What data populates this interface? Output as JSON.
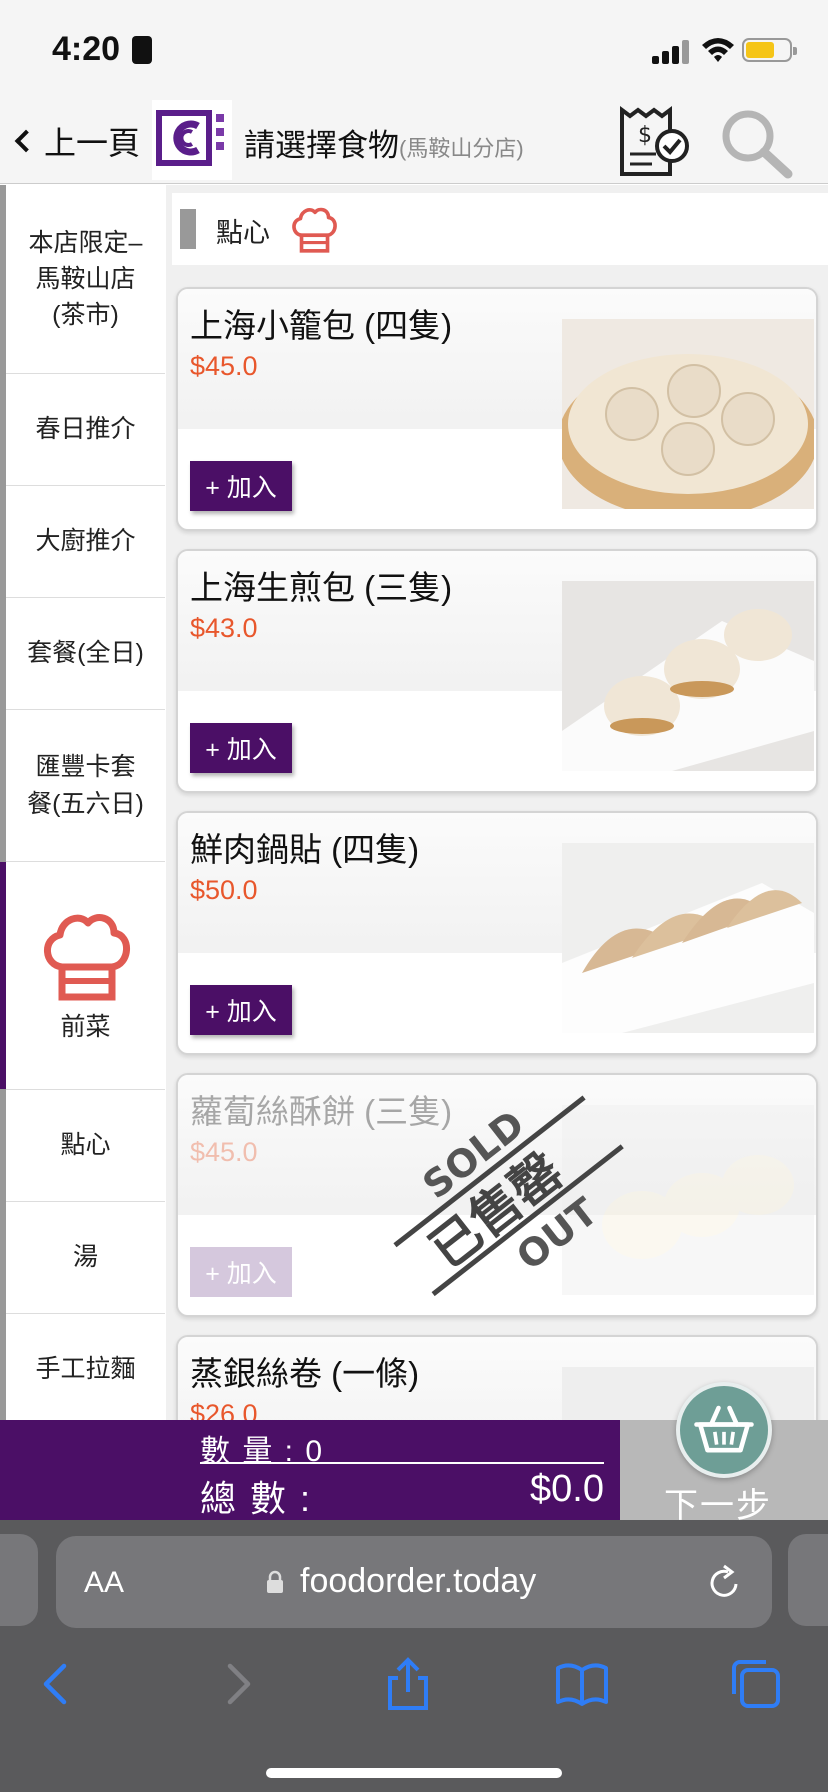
{
  "status": {
    "time": "4:20"
  },
  "header": {
    "back_label": "上一頁",
    "title": "請選擇食物",
    "branch": "(馬鞍山分店)"
  },
  "sidebar": {
    "items": [
      {
        "label": "本店限定–\n馬鞍山店\n(茶市)"
      },
      {
        "label": "春日推介"
      },
      {
        "label": "大廚推介"
      },
      {
        "label": "套餐(全日)"
      },
      {
        "label": "匯豐卡套\n餐(五六日)"
      },
      {
        "label": "前菜"
      },
      {
        "label": "點心"
      },
      {
        "label": "湯"
      },
      {
        "label": "手工拉麵"
      }
    ]
  },
  "section": {
    "title": "點心"
  },
  "menu": {
    "add_label": "+ 加入",
    "items": [
      {
        "name": "上海小籠包 (四隻)",
        "price": "$45.0",
        "sold_out": false
      },
      {
        "name": "上海生煎包 (三隻)",
        "price": "$43.0",
        "sold_out": false
      },
      {
        "name": "鮮肉鍋貼 (四隻)",
        "price": "$50.0",
        "sold_out": false
      },
      {
        "name": "蘿蔔絲酥餅 (三隻)",
        "price": "$45.0",
        "sold_out": true
      },
      {
        "name": "蒸銀絲卷 (一條)",
        "price": "$26.0",
        "sold_out": false
      }
    ],
    "sold_stamp": {
      "top": "SOLD",
      "middle": "已售罄",
      "bottom": "OUT"
    }
  },
  "cart": {
    "qty_label": "數 量 :",
    "qty": "0",
    "total_label": "總 數 :",
    "total": "$0.0",
    "next_label": "下一步"
  },
  "browser": {
    "aa_label": "AA",
    "url": "foodorder.today"
  },
  "colors": {
    "brand_purple": "#4b0f66",
    "price_orange": "#e8572c",
    "chef_red": "#e05a52"
  }
}
